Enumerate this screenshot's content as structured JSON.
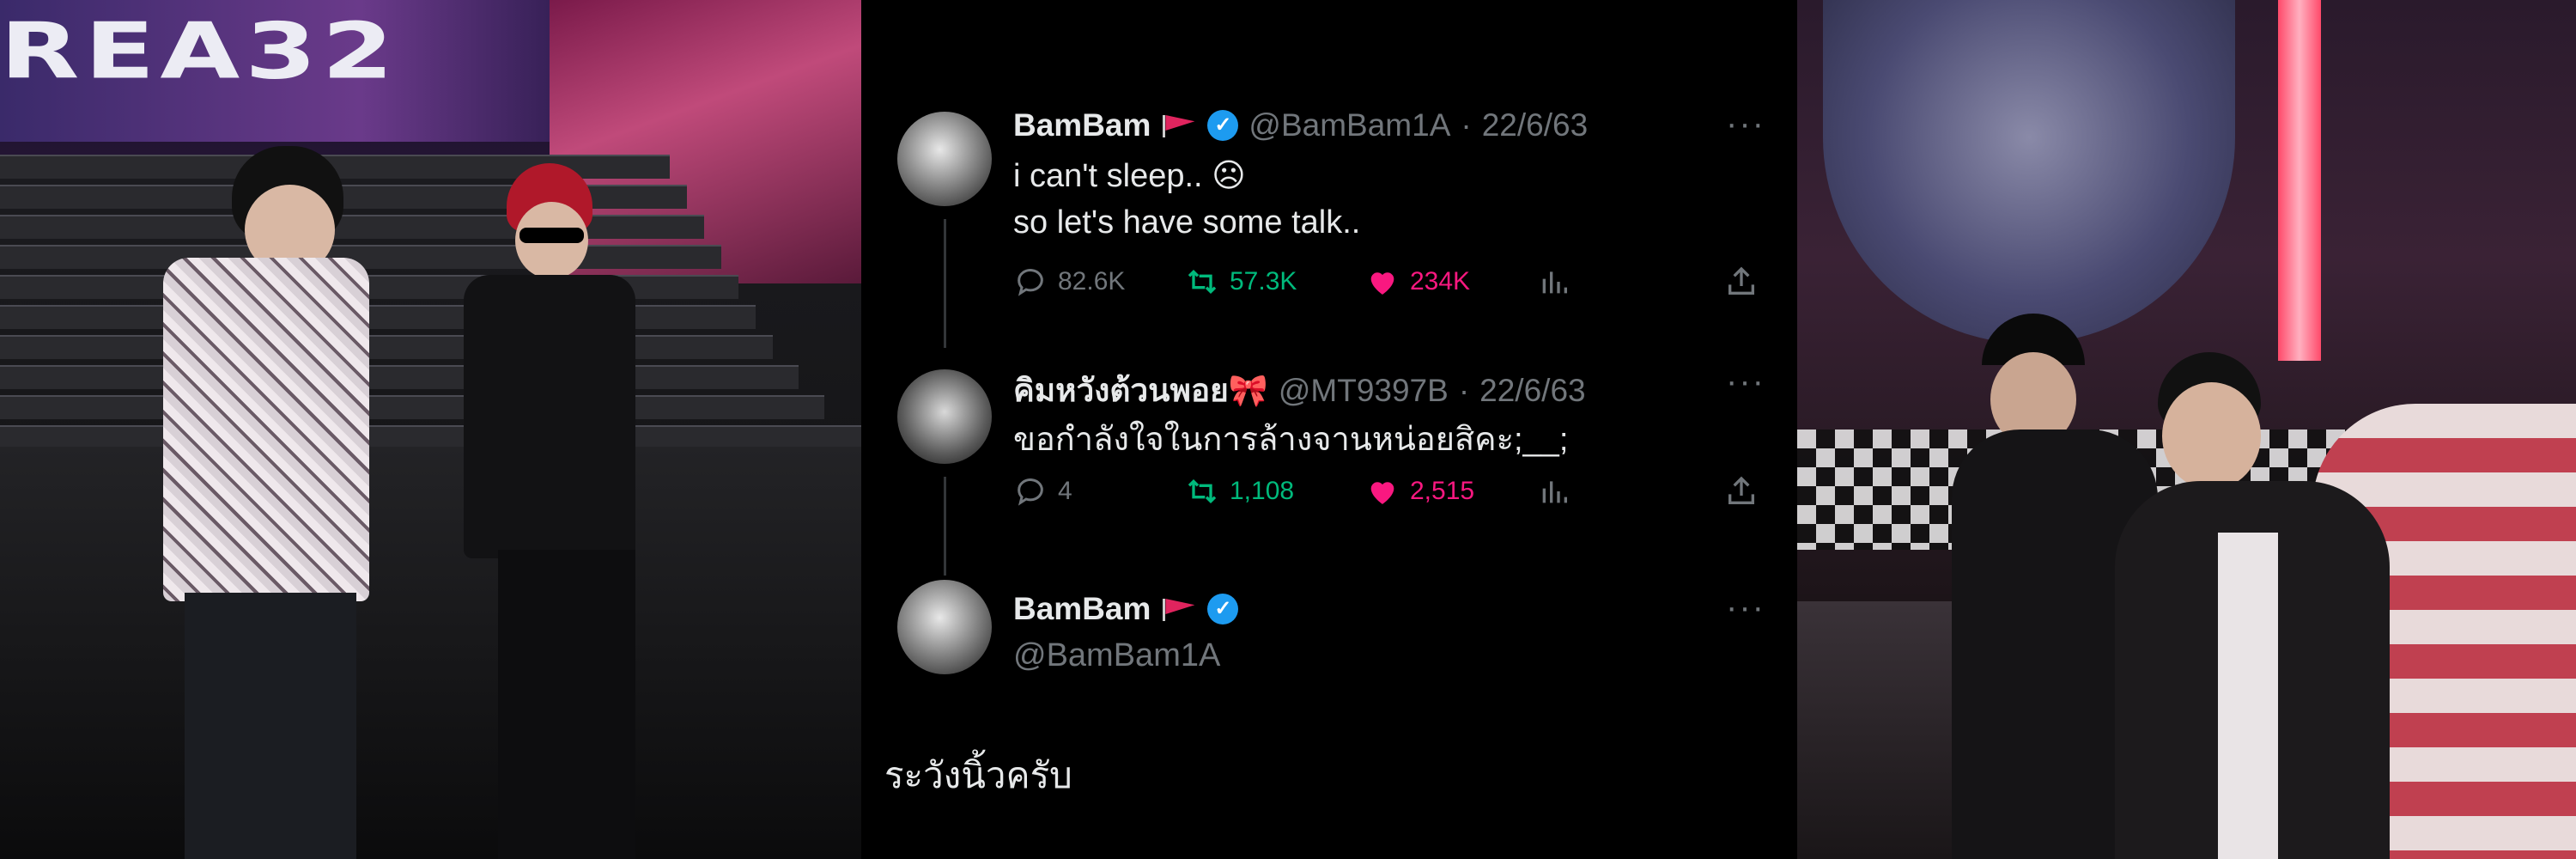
{
  "left_photo": {
    "sign_text": "REA32"
  },
  "tweets": [
    {
      "display_name": "BamBam",
      "handle": "@BamBam1A",
      "date": "22/6/63",
      "text": "i can't sleep.. ☹\nso let's have some talk..",
      "replies": "82.6K",
      "retweets": "57.3K",
      "likes": "234K"
    },
    {
      "display_name": "คิมหวังต้วนพอย🎀",
      "handle": "@MT9397B",
      "date": "22/6/63",
      "text": "ขอกำลังใจในการล้างจานหน่อยสิคะ;__;",
      "replies": "4",
      "retweets": "1,108",
      "likes": "2,515"
    },
    {
      "display_name": "BamBam",
      "handle": "@BamBam1A",
      "text": "ระวังนิ้วครับ"
    }
  ],
  "colors": {
    "background": "#000000",
    "text": "#e7e9ea",
    "muted": "#71767b",
    "verified": "#1d9bf0",
    "retweet": "#00ba7c",
    "like": "#f91880"
  },
  "icons": {
    "reply": "speech-bubble-icon",
    "retweet": "retweet-arrows-icon",
    "like": "heart-icon",
    "views": "bar-chart-icon",
    "share": "share-upload-icon",
    "more": "ellipsis-icon"
  }
}
